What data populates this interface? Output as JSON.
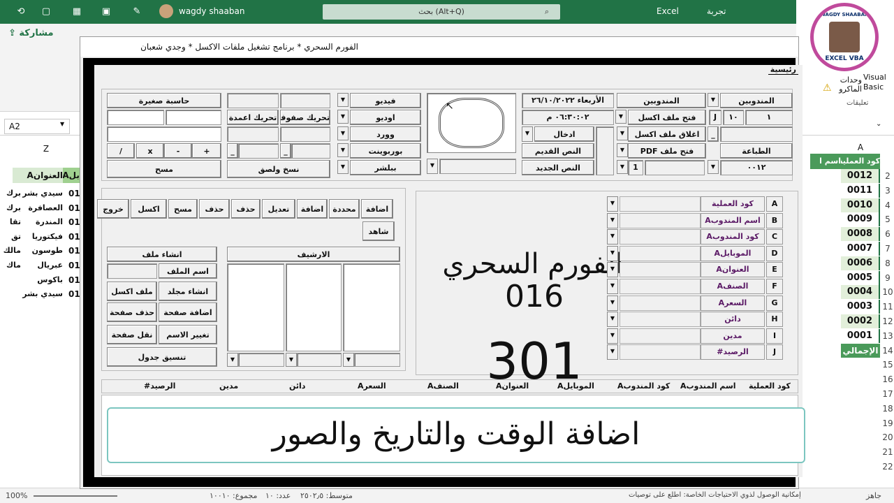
{
  "excel": {
    "user": "wagdy shaaban",
    "search": "بحث (Alt+Q)",
    "app": "Excel",
    "doc": "تجربة",
    "share": "مشاركة",
    "namebox": "A2",
    "col_z": "Z",
    "col_a": "A",
    "left_header": [
      "العنوانA",
      "ابلA"
    ],
    "left_rows": [
      {
        "name": "سيدي بشر",
        "extra": "برك",
        "num": "01"
      },
      {
        "name": "العصافرة",
        "extra": "برك",
        "num": "01"
      },
      {
        "name": "المندرة",
        "extra": "تقا",
        "num": "01"
      },
      {
        "name": "فيكتوريا",
        "extra": "تق",
        "num": "01"
      },
      {
        "name": "طوسون",
        "extra": "مالك",
        "num": "01"
      },
      {
        "name": "عبريال",
        "extra": "ماك",
        "num": "01"
      },
      {
        "name": "باكوس",
        "extra": "",
        "num": "01"
      },
      {
        "name": "سيدي بشر",
        "extra": "",
        "num": "01"
      }
    ],
    "right_header": [
      "كود العملية",
      "اسم ا"
    ],
    "right_rows": [
      "0012",
      "0011",
      "0010",
      "0009",
      "0008",
      "0007",
      "0006",
      "0005",
      "0004",
      "0003",
      "0002",
      "0001"
    ],
    "right_total": "الإجمالي",
    "row_numbers": [
      "2",
      "3",
      "4",
      "5",
      "6",
      "7",
      "8",
      "9",
      "10",
      "11",
      "12",
      "13",
      "14",
      "15",
      "16",
      "17",
      "18",
      "19",
      "20",
      "21",
      "22"
    ],
    "ribbon_right": [
      "Visual Basic",
      "وحدات الماكرو",
      "تعليقات"
    ],
    "status": {
      "ready": "جاهز",
      "access": "إمكانية الوصول لذوي الاحتياجات الخاصة: اطلع على توصيات",
      "avg": "متوسط: ٢٥٠٢٫٥",
      "count": "عدد: ١٠",
      "sum": "مجموع: ١٠٠١٠",
      "zoom": "100%"
    },
    "logo_top": "WAGDY SHAABAN",
    "logo_bottom": "EXCEL VBA"
  },
  "dialog": {
    "title": "الفورم السحري * برنامج تشغيل ملفات الاكسل * وجدي شعبان",
    "tab": "رئيسية",
    "calc_title": "حاسبة صغيرة",
    "calc_ops": [
      "/",
      "x",
      "-",
      "+"
    ],
    "calc_clear": "مسح",
    "copy_paste": "نسخ ولصق",
    "move_rows": "تحريك صفوف",
    "move_cols": "تحريك اعمدة",
    "apps": [
      "فيديو",
      "اوديو",
      "وورد",
      "بوربوينت",
      "ببلشر"
    ],
    "date": "الأربعاء ٢٦/١٠/٢٠٢٢",
    "time": "٠٦:٣٠:٠٢ م",
    "enter": "ادخال",
    "old_text": "النص القديم",
    "new_text": "النص الجديد",
    "delegate_lbl": "المندوبين",
    "delegate_val": "المندوبين",
    "open_excel": "فتح ملف اكسل",
    "close_excel": "اغلاق ملف اكسل",
    "open_pdf": "فتح ملف PDF",
    "print": "الطباعة",
    "j_val": "J",
    "ten_val": "١٠",
    "one_val": "١",
    "code_val": "٠٠١٢",
    "one_b": "1",
    "actions": [
      "اضافة",
      "محددة",
      "اضافة",
      "تعديل",
      "حذف",
      "حذف",
      "مسح",
      "اكسل",
      "خروج"
    ],
    "view": "شاهد",
    "create_file": "انشاء ملف",
    "archive": "الارشيف",
    "file_name": "اسم الملف",
    "create_folder": "انشاء مجلد",
    "excel_file": "ملف اكسل",
    "add_sheet": "اضافة صفحة",
    "del_sheet": "حذف صفحة",
    "rename": "تغيير الاسم",
    "move_sheet": "نقل صفحة",
    "format_table": "تنسيق جدول",
    "fields": [
      {
        "letter": "A",
        "label": "كود العملية"
      },
      {
        "letter": "B",
        "label": "اسم المندوبA"
      },
      {
        "letter": "C",
        "label": "كود المندوبA"
      },
      {
        "letter": "D",
        "label": "الموبايلA"
      },
      {
        "letter": "E",
        "label": "العنوانA"
      },
      {
        "letter": "F",
        "label": "الصنفA"
      },
      {
        "letter": "G",
        "label": "السعرA"
      },
      {
        "letter": "H",
        "label": "دائن"
      },
      {
        "letter": "I",
        "label": "مدين"
      },
      {
        "letter": "J",
        "label": "الرصيد#"
      }
    ],
    "big_title": "الفورم السحري",
    "big_num1": "016",
    "big_num2": "301",
    "list_headers": [
      "كود العملية",
      "اسم المندوبA",
      "كود المندوبA",
      "الموبايلA",
      "العنوانA",
      "الصنفA",
      "السعرA",
      "دائن",
      "مدين",
      "الرصيد#"
    ],
    "banner": "اضافة الوقت والتاريخ والصور"
  }
}
